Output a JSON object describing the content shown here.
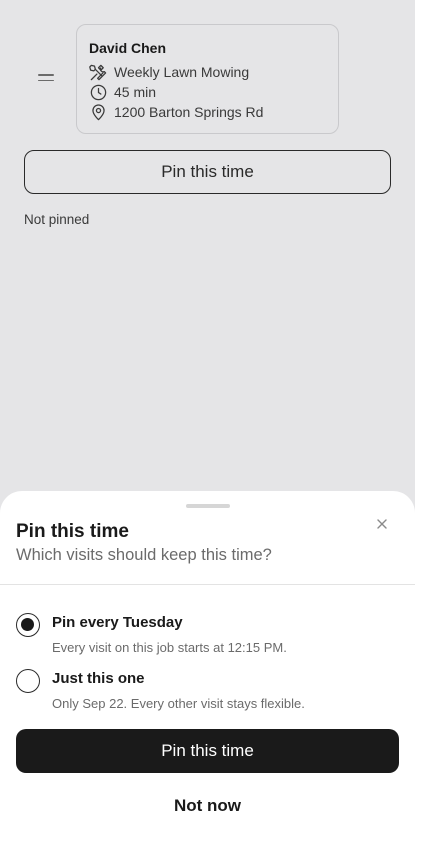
{
  "job": {
    "client_name": "David Chen",
    "service": "Weekly Lawn Mowing",
    "duration": "45 min",
    "address": "1200 Barton Springs Rd"
  },
  "pin_button_label": "Pin this time",
  "pin_status": "Not pinned",
  "sheet": {
    "title": "Pin this time",
    "subtitle": "Which visits should keep this time?",
    "options": [
      {
        "label": "Pin every Tuesday",
        "description": "Every visit on this job starts at 12:15 PM.",
        "selected": true
      },
      {
        "label": "Just this one",
        "description": "Only Sep 22. Every other visit stays flexible.",
        "selected": false
      }
    ],
    "primary_label": "Pin this time",
    "secondary_label": "Not now"
  },
  "icons": {
    "service": "tools-icon",
    "duration": "clock-icon",
    "address": "map-pin-icon",
    "close": "close-icon",
    "reorder": "drag-handle-icon"
  }
}
